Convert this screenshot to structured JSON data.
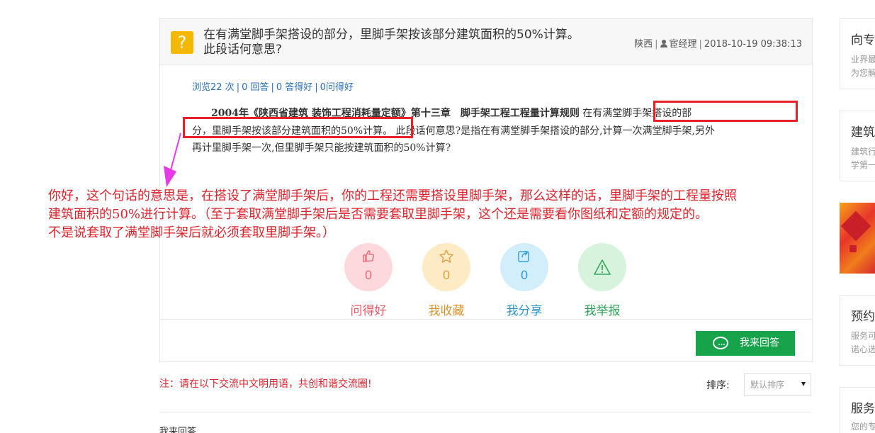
{
  "question": {
    "title_line1": "在有满堂脚手架搭设的部分，里脚手架按该部分建筑面积的50%计算。",
    "title_line2": "此段话何意思?",
    "region": "陕西",
    "author": "宦经理",
    "datetime": "2018-10-19 09:38:13",
    "stats": {
      "views": "浏览22 次",
      "answers": "0 回答",
      "good_answers": "0 答得好",
      "good_questions": "0问得好"
    },
    "body": {
      "bold_part": "2004年《陕西省建筑 装饰工程消耗量定额》第十三章　脚手架工程工程量计算规则",
      "line1_rest": "在有满堂脚手架搭设的部",
      "line2_hl": "分，里脚手架按该部分建筑面积的50%计算。",
      "line2_rest": "此段话何意思?是指在有满堂脚手架搭设的部分,计算一次满堂脚手架,另外",
      "line3": "再计里脚手架一次,但里脚手架只能按建筑面积的50%计算?"
    }
  },
  "annotation": {
    "line1": "你好，这个句话的意思是，在搭设了满堂脚手架后，你的工程还需要搭设里脚手架，那么这样的话，里脚手架的工程量按照",
    "line2": "建筑面积的50%进行计算。（至于套取满堂脚手架后是否需要套取里脚手架，这个还是需要看你图纸和定额的规定的。",
    "line3": "不是说套取了满堂脚手架后就必须套取里脚手架。）"
  },
  "actions": [
    {
      "label": "问得好",
      "count": "0",
      "icon": "thumbs-up-icon"
    },
    {
      "label": "我收藏",
      "count": "0",
      "icon": "star-icon"
    },
    {
      "label": "我分享",
      "count": "0",
      "icon": "share-icon"
    },
    {
      "label": "我举报",
      "icon": "warning-icon"
    }
  ],
  "answer_button": "我来回答",
  "note": "注：请在以下交流中文明用语，共创和谐交流圈!",
  "sort": {
    "label": "排序:",
    "selected": "默认排序"
  },
  "my_answer_heading": "我来回答",
  "sidebar": [
    {
      "title": "向专",
      "desc1": "业界最",
      "desc2": "为您解"
    },
    {
      "title": "建筑",
      "desc1": "建筑行",
      "desc2": "学第一"
    },
    {
      "title": "预约",
      "desc1": "服务可",
      "desc2": "诺心选"
    },
    {
      "title": "服务",
      "desc1": "您的专"
    }
  ],
  "colors": {
    "accent_red": "#e0232b",
    "link_blue": "#2a6fb8",
    "answer_green": "#17a34a",
    "question_icon": "#f5b800"
  }
}
